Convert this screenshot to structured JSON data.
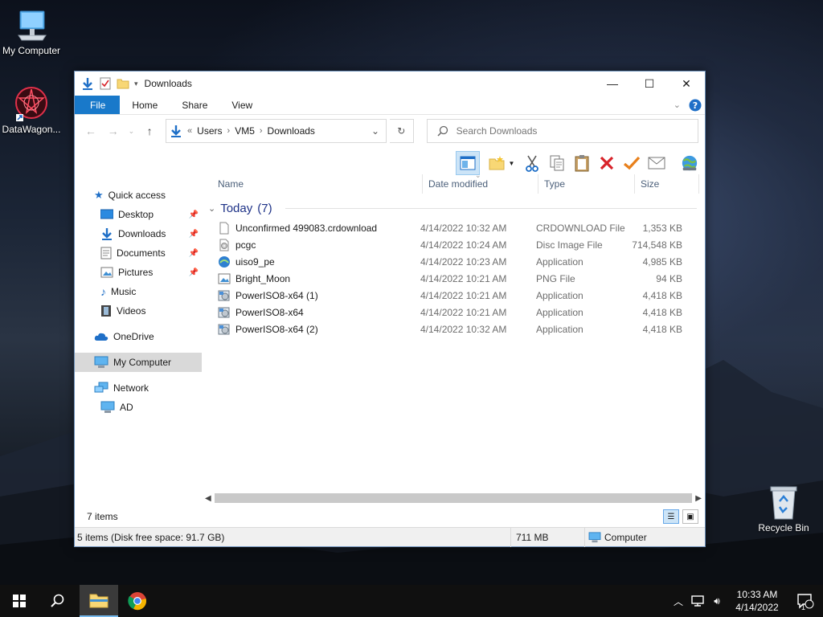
{
  "desktop": {
    "icons": [
      {
        "label": "My Computer"
      },
      {
        "label": "DataWagon..."
      },
      {
        "label": "Recycle Bin"
      }
    ]
  },
  "window": {
    "title": "Downloads",
    "ribbon": {
      "file": "File",
      "home": "Home",
      "share": "Share",
      "view": "View"
    },
    "address": {
      "overflow": "«",
      "crumbs": [
        "Users",
        "VM5",
        "Downloads"
      ]
    },
    "search": {
      "placeholder": "Search Downloads"
    },
    "columns": {
      "name": "Name",
      "date": "Date modified",
      "type": "Type",
      "size": "Size"
    },
    "group": {
      "label": "Today",
      "count": "(7)"
    },
    "files": [
      {
        "name": "Unconfirmed 499083.crdownload",
        "date": "4/14/2022 10:32 AM",
        "type": "CRDOWNLOAD File",
        "size": "1,353 KB",
        "icon": "blank-file-icon"
      },
      {
        "name": "pcgc",
        "date": "4/14/2022 10:24 AM",
        "type": "Disc Image File",
        "size": "714,548 KB",
        "icon": "disc-image-icon"
      },
      {
        "name": "uiso9_pe",
        "date": "4/14/2022 10:23 AM",
        "type": "Application",
        "size": "4,985 KB",
        "icon": "ultraiso-app-icon"
      },
      {
        "name": "Bright_Moon",
        "date": "4/14/2022 10:21 AM",
        "type": "PNG File",
        "size": "94 KB",
        "icon": "image-file-icon"
      },
      {
        "name": "PowerISO8-x64 (1)",
        "date": "4/14/2022 10:21 AM",
        "type": "Application",
        "size": "4,418 KB",
        "icon": "poweriso-app-icon"
      },
      {
        "name": "PowerISO8-x64",
        "date": "4/14/2022 10:21 AM",
        "type": "Application",
        "size": "4,418 KB",
        "icon": "poweriso-app-icon"
      },
      {
        "name": "PowerISO8-x64 (2)",
        "date": "4/14/2022 10:32 AM",
        "type": "Application",
        "size": "4,418 KB",
        "icon": "poweriso-app-icon"
      }
    ],
    "nav": {
      "quick_access": "Quick access",
      "desktop": "Desktop",
      "downloads": "Downloads",
      "documents": "Documents",
      "pictures": "Pictures",
      "music": "Music",
      "videos": "Videos",
      "onedrive": "OneDrive",
      "my_computer": "My Computer",
      "network": "Network",
      "ad": "AD"
    },
    "items_count": "7 items",
    "status": {
      "left": "5 items (Disk free space: 91.7 GB)",
      "size": "711 MB",
      "location": "Computer"
    }
  },
  "taskbar": {
    "time": "10:33 AM",
    "date": "4/14/2022",
    "notifications": "1"
  },
  "colors": {
    "accent": "#1979ca",
    "selection": "#cce4f7",
    "group_text": "#1e3287",
    "delete_red": "#d8232a",
    "check_orange": "#e8801c"
  }
}
